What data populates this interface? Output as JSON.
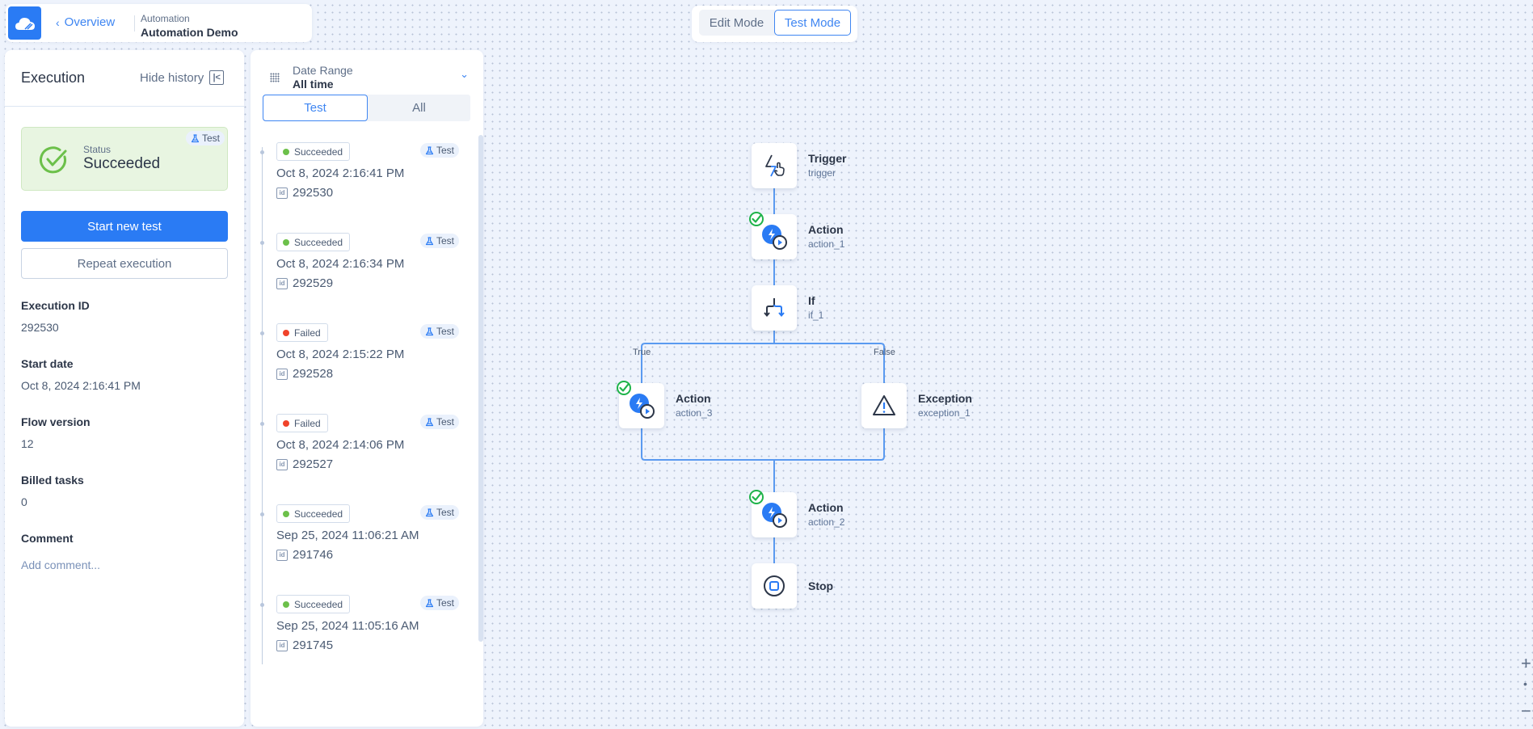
{
  "header": {
    "logo_icon": "cloud-icon",
    "back_label": "Overview",
    "breadcrumb_parent": "Automation",
    "title": "Automation Demo"
  },
  "mode": {
    "edit_label": "Edit Mode",
    "test_label": "Test Mode",
    "active": "Test Mode"
  },
  "execution": {
    "title": "Execution",
    "hide_history_label": "Hide history",
    "status_label": "Status",
    "status_value": "Succeeded",
    "status_pill": "Test",
    "start_test_label": "Start new test",
    "repeat_label": "Repeat execution",
    "fields": [
      {
        "label": "Execution ID",
        "value": "292530"
      },
      {
        "label": "Start date",
        "value": "Oct 8, 2024 2:16:41 PM"
      },
      {
        "label": "Flow version",
        "value": "12"
      },
      {
        "label": "Billed tasks",
        "value": "0"
      }
    ],
    "comment_label": "Comment",
    "comment_placeholder": "Add comment..."
  },
  "history": {
    "date_range_label": "Date Range",
    "date_range_value": "All time",
    "filters": [
      "Test",
      "All"
    ],
    "active_filter": "Test",
    "items": [
      {
        "status": "Succeeded",
        "pill": "Test",
        "date": "Oct 8, 2024 2:16:41 PM",
        "id": "292530"
      },
      {
        "status": "Succeeded",
        "pill": "Test",
        "date": "Oct 8, 2024 2:16:34 PM",
        "id": "292529"
      },
      {
        "status": "Failed",
        "pill": "Test",
        "date": "Oct 8, 2024 2:15:22 PM",
        "id": "292528"
      },
      {
        "status": "Failed",
        "pill": "Test",
        "date": "Oct 8, 2024 2:14:06 PM",
        "id": "292527"
      },
      {
        "status": "Succeeded",
        "pill": "Test",
        "date": "Sep 25, 2024 11:06:21 AM",
        "id": "291746"
      },
      {
        "status": "Succeeded",
        "pill": "Test",
        "date": "Sep 25, 2024 11:05:16 AM",
        "id": "291745"
      }
    ]
  },
  "flow": {
    "nodes": [
      {
        "key": "trigger",
        "title": "Trigger",
        "sub": "trigger",
        "icon": "trigger-icon",
        "executed": false
      },
      {
        "key": "action_1",
        "title": "Action",
        "sub": "action_1",
        "icon": "action-icon",
        "executed": true
      },
      {
        "key": "if_1",
        "title": "If",
        "sub": "if_1",
        "icon": "branch-icon",
        "executed": false
      },
      {
        "key": "action_3",
        "title": "Action",
        "sub": "action_3",
        "icon": "action-icon",
        "executed": true
      },
      {
        "key": "exception_1",
        "title": "Exception",
        "sub": "exception_1",
        "icon": "warning-icon",
        "executed": false
      },
      {
        "key": "action_2",
        "title": "Action",
        "sub": "action_2",
        "icon": "action-icon",
        "executed": true
      },
      {
        "key": "stop",
        "title": "Stop",
        "sub": "",
        "icon": "stop-icon",
        "executed": false
      }
    ],
    "true_label": "True",
    "false_label": "False"
  },
  "zoom_controls": {
    "zoom_in": "+",
    "reset": "•",
    "zoom_out": "−"
  },
  "colors": {
    "accent": "#2a7bf4",
    "success": "#6cc04a",
    "failed": "#f0432a",
    "connector": "#5a9af0",
    "check": "#1fb34a"
  }
}
